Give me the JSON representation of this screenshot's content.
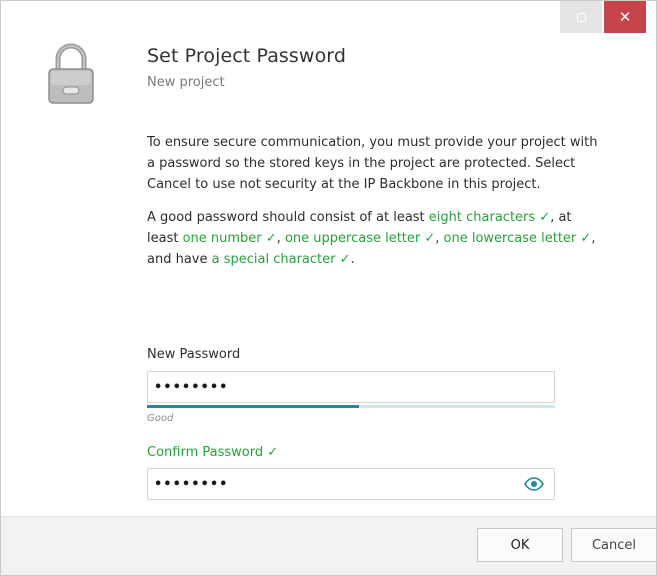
{
  "window": {
    "title": "Set Project Password",
    "subtitle": "New project"
  },
  "titlebar": {
    "close_label": "✕"
  },
  "intro": "To ensure secure communication, you must provide your project with a password so the stored keys in the project are protected. Select Cancel to use not security at the IP Backbone in this project.",
  "requirements": {
    "prefix": "A good password should consist of at least ",
    "eight_characters": "eight characters ✓",
    "sep1": ", at least ",
    "one_number": "one number ✓",
    "sep2": ", ",
    "one_uppercase": "one uppercase letter ✓",
    "sep3": ", ",
    "one_lowercase": "one lowercase letter ✓",
    "sep4": ", and have ",
    "special_character": "a special character ✓",
    "suffix": "."
  },
  "new_password": {
    "label": "New Password",
    "value": "••••••••",
    "strength_label": "Good",
    "strength_fraction": 0.52
  },
  "confirm_password": {
    "label": "Confirm Password ✓",
    "value": "••••••••"
  },
  "footer": {
    "ok_label": "OK",
    "cancel_label": "Cancel"
  },
  "colors": {
    "accent": "#1d8aa0",
    "success": "#27a13a",
    "close": "#c7444a"
  },
  "icons": {
    "lock": "lock-icon",
    "eye": "eye-icon",
    "restore": "restore-icon",
    "close": "close-icon"
  }
}
